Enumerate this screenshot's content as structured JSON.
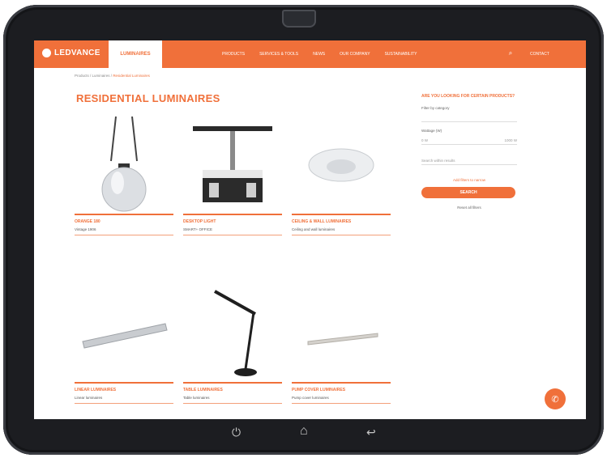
{
  "header": {
    "brand": "LEDVANCE",
    "active_tab": "LUMINAIRES",
    "nav": [
      "PRODUCTS",
      "SERVICES & TOOLS",
      "NEWS",
      "OUR COMPANY",
      "SUSTAINABILITY"
    ],
    "contact": "CONTACT"
  },
  "breadcrumb": {
    "parent": "Products / Luminaires",
    "current": "Residential Luminaires"
  },
  "page": {
    "title": "RESIDENTIAL LUMINAIRES"
  },
  "products": [
    {
      "title": "ORANGE 180",
      "subtitle": "Vintage 1906"
    },
    {
      "title": "DESKTOP LIGHT",
      "subtitle": "SMART+ OFFICE"
    },
    {
      "title": "CEILING & WALL LUMINAIRES",
      "subtitle": "Ceiling and wall luminaires"
    },
    {
      "title": "LINEAR LUMINAIRES",
      "subtitle": "Linear luminaires"
    },
    {
      "title": "TABLE LUMINAIRES",
      "subtitle": "Table luminaires"
    },
    {
      "title": "PUMP COVER LUMINAIRES",
      "subtitle": "Pump cover luminaires"
    }
  ],
  "sidebar": {
    "heading": "ARE YOU LOOKING FOR CERTAIN PRODUCTS?",
    "filter_label": "Filter by category",
    "wattage_label": "Wattage (W)",
    "wattage_min": "0 W",
    "wattage_max": "1000 W",
    "search_placeholder": "Search within results",
    "more_link": "Add filters to narrow",
    "search_button": "SEARCH",
    "reset": "Reset all filters"
  },
  "icons": {
    "search": "search-icon",
    "chat": "chat-icon",
    "power": "power-icon",
    "home": "home-icon",
    "back": "back-icon"
  },
  "colors": {
    "accent": "#f0703a",
    "device": "#1c1d21"
  }
}
